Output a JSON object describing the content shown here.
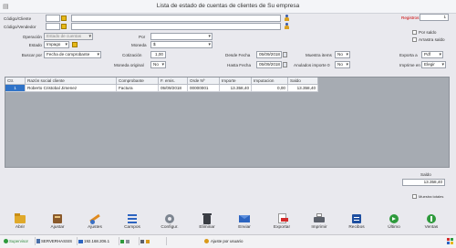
{
  "window": {
    "title": "Lista de estado de cuentas de clientes  de Su empresa"
  },
  "filters": {
    "cliente_label": "Código/Cliente",
    "vendedor_label": "Código/Vendedor",
    "operacion_label": "Operación",
    "operacion_value": "Estado de cuentas",
    "estado_label": "Estado",
    "estado_value": "Impago",
    "buscar_label": "Buscar por",
    "buscar_value": "Fecha de comprobante",
    "por_label": "Por",
    "por_value": "",
    "moneda_label": "Moneda",
    "moneda_value": "$",
    "cotizacion_label": "Cotización",
    "cotizacion_value": "1,00",
    "moneda_original_label": "Moneda original",
    "moneda_original_value": "No",
    "desde_label": "Desde Fecha",
    "desde_value": "05/09/2018",
    "hasta_label": "Hasta Fecha",
    "hasta_value": "05/09/2018",
    "muestra_items_label": "Muestra items",
    "muestra_items_value": "No",
    "anulados_label": "Anulados importe 0",
    "anulados_value": "No",
    "registros_label": "Registros",
    "registros_value": "1",
    "por_saldo_label": "Por saldo",
    "arrastra_saldo_label": "Arrastra saldo",
    "exporta_label": "Exporta a",
    "exporta_value": "Pdf",
    "imprime_label": "Imprime en",
    "imprime_value": "Elegir"
  },
  "table": {
    "columns": [
      "Ctr.",
      "Razón social cliente",
      "Comprobante",
      "F. emis.",
      "Orde Nº",
      "Importe",
      "Imputacion",
      "Saldo"
    ],
    "rows": [
      [
        "1",
        "Roberto Cristobal Jimenez",
        "Factura",
        "05/09/2018",
        "00000001",
        "13.358,40",
        "0,00",
        "13.358,40"
      ]
    ]
  },
  "saldo": {
    "label": "Saldo",
    "value": "13.358,40",
    "ocultar_label": "Muestra totales"
  },
  "toolbar": [
    "Abrir",
    "Ajustar",
    "Ajustes",
    "Campos",
    "Configur.",
    "Eliminar",
    "Enviar",
    "Exportar",
    "Imprimir",
    "Recibos",
    "Último",
    "Ventas"
  ],
  "status": {
    "usuario": "Supervisor",
    "server": "SERVERHASSIS",
    "ip": "192.168.206.1",
    "ayuda": "Ajuste por usuario"
  },
  "colors": {
    "accent": "#2f73c8",
    "registros": "#cc0000",
    "grid_bg": "#a6abb2"
  }
}
